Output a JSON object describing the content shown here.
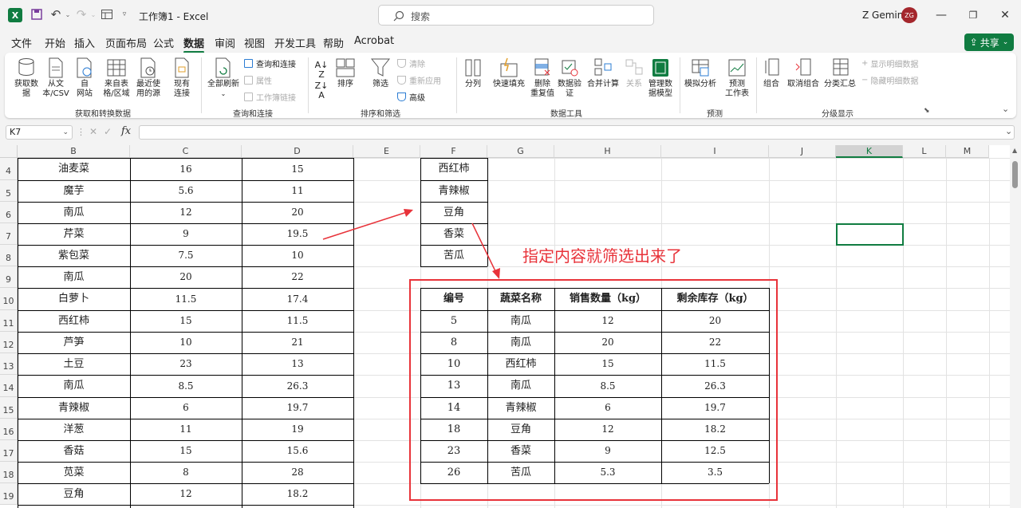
{
  "titlebar": {
    "title": "工作簿1 - Excel",
    "search_placeholder": "搜索",
    "user": "Z Gemini",
    "avatar_initials": "ZG"
  },
  "menu": {
    "items": [
      "文件",
      "开始",
      "插入",
      "页面布局",
      "公式",
      "数据",
      "审阅",
      "视图",
      "开发工具",
      "帮助",
      "Acrobat"
    ],
    "active": "数据",
    "share": "共享"
  },
  "ribbon": {
    "get_data": [
      "获取数\n据",
      "从文\n本/CSV",
      "自\n网站",
      "来自表\n格/区域",
      "最近使\n用的源",
      "现有\n连接"
    ],
    "get_group": "获取和转换数据",
    "refresh": "全部刷新",
    "query_items": [
      "查询和连接",
      "属性",
      "工作簿链接"
    ],
    "query_group": "查询和连接",
    "sort_az": "排序",
    "filter": "筛选",
    "filter_items": [
      "清除",
      "重新应用",
      "高级"
    ],
    "sort_group": "排序和筛选",
    "tools": [
      "分列",
      "快速填充",
      "删除\n重复值",
      "数据验\n证",
      "合并计算",
      "关系",
      "管理数\n据模型"
    ],
    "tools_group": "数据工具",
    "forecast": [
      "模拟分析",
      "预测\n工作表"
    ],
    "forecast_group": "预测",
    "outline": [
      "组合",
      "取消组合",
      "分类汇总"
    ],
    "outline_items": [
      "显示明细数据",
      "隐藏明细数据"
    ],
    "outline_group": "分级显示"
  },
  "formula": {
    "namebox": "K7",
    "fx": "fx",
    "value": ""
  },
  "columns": [
    "B",
    "C",
    "D",
    "E",
    "F",
    "G",
    "H",
    "I",
    "J",
    "K",
    "L",
    "M"
  ],
  "rows": [
    "4",
    "5",
    "6",
    "7",
    "8",
    "9",
    "10",
    "11",
    "12",
    "13",
    "14",
    "15",
    "16",
    "17",
    "18",
    "19"
  ],
  "left_table": [
    [
      "油麦菜",
      "16",
      "15"
    ],
    [
      "魔芋",
      "5.6",
      "11"
    ],
    [
      "南瓜",
      "12",
      "20"
    ],
    [
      "芹菜",
      "9",
      "19.5"
    ],
    [
      "紫包菜",
      "7.5",
      "10"
    ],
    [
      "南瓜",
      "20",
      "22"
    ],
    [
      "白萝卜",
      "11.5",
      "17.4"
    ],
    [
      "西红柿",
      "15",
      "11.5"
    ],
    [
      "芦笋",
      "10",
      "21"
    ],
    [
      "土豆",
      "23",
      "13"
    ],
    [
      "南瓜",
      "8.5",
      "26.3"
    ],
    [
      "青辣椒",
      "6",
      "19.7"
    ],
    [
      "洋葱",
      "11",
      "19"
    ],
    [
      "香菇",
      "15",
      "15.6"
    ],
    [
      "苋菜",
      "8",
      "28"
    ],
    [
      "豆角",
      "12",
      "18.2"
    ]
  ],
  "criteria": [
    "西红柿",
    "青辣椒",
    "豆角",
    "香菜",
    "苦瓜"
  ],
  "annotation": "指定内容就筛选出来了",
  "result": {
    "headers": [
      "编号",
      "蔬菜名称",
      "销售数量（kg）",
      "剩余库存（kg）"
    ],
    "rows": [
      [
        "5",
        "南瓜",
        "12",
        "20"
      ],
      [
        "8",
        "南瓜",
        "20",
        "22"
      ],
      [
        "10",
        "西红柿",
        "15",
        "11.5"
      ],
      [
        "13",
        "南瓜",
        "8.5",
        "26.3"
      ],
      [
        "14",
        "青辣椒",
        "6",
        "19.7"
      ],
      [
        "18",
        "豆角",
        "12",
        "18.2"
      ],
      [
        "23",
        "香菜",
        "9",
        "12.5"
      ],
      [
        "26",
        "苦瓜",
        "5.3",
        "3.5"
      ]
    ]
  },
  "colors": {
    "accent": "#107c41",
    "annotation": "#e8333a"
  }
}
